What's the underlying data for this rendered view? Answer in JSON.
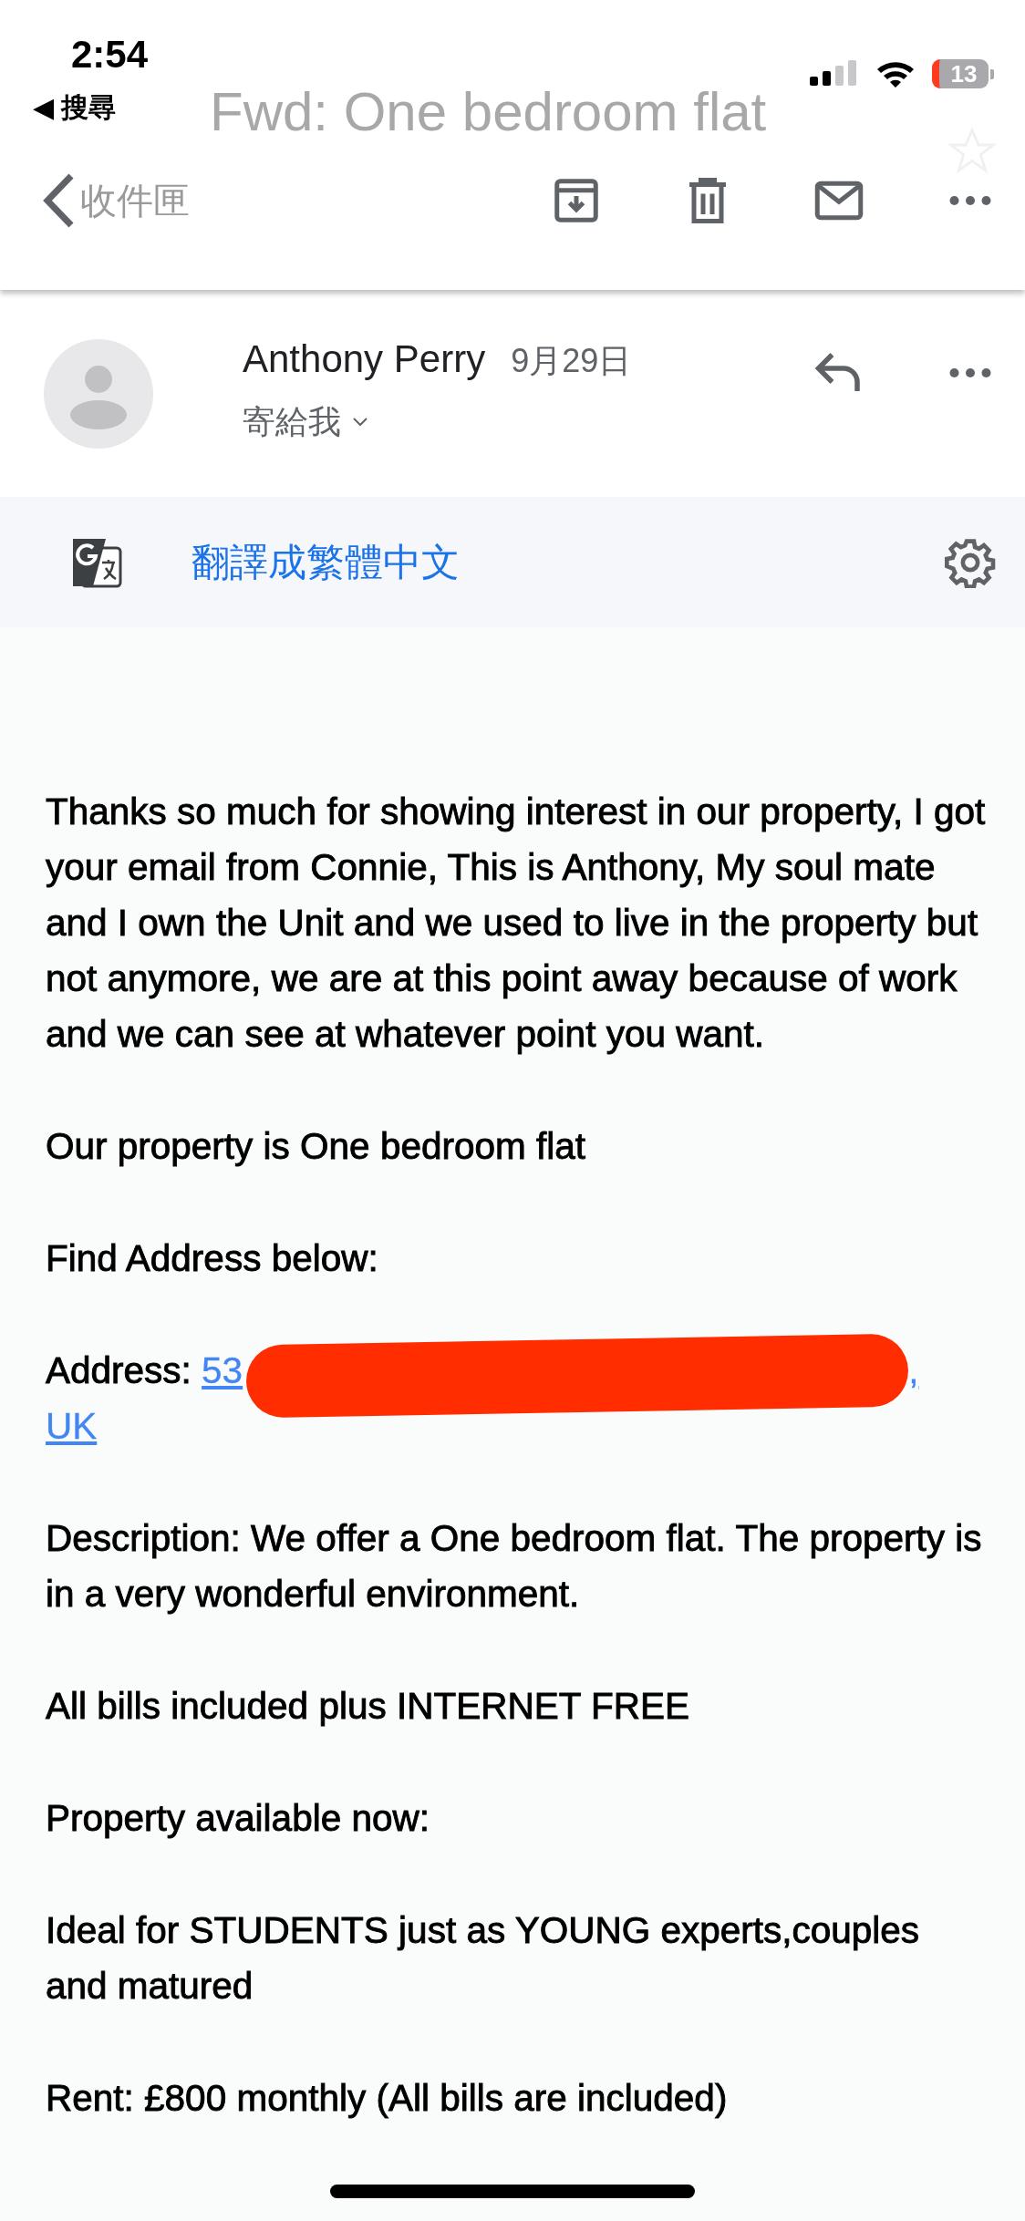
{
  "status_bar": {
    "time": "2:54",
    "back_app": "◀ 搜尋",
    "battery": "13"
  },
  "toolbar": {
    "faded_title": "Fwd: One bedroom flat",
    "back_label": "收件匣"
  },
  "sender": {
    "name": "Anthony Perry",
    "date": "9月29日",
    "recipient": "寄給我"
  },
  "translate_bar": {
    "label": "翻譯成繁體中文"
  },
  "body": [
    {
      "kind": "text",
      "text": "Thanks so much for showing interest in our property, I got your email from Connie, This is Anthony, My soul mate and I own the Unit and we used to live in the property but not anymore, we are at this point away because of work and we can see at whatever point you want."
    },
    {
      "kind": "text",
      "text": "Our property is One bedroom flat"
    },
    {
      "kind": "text",
      "text": "Find Address below:"
    },
    {
      "kind": "address",
      "label": "Address:",
      "link_start": "53",
      "link_end": ",",
      "link_last": "UK",
      "redacted": true
    },
    {
      "kind": "text",
      "text": "Description: We offer a One bedroom flat. The property is in a very wonderful environment."
    },
    {
      "kind": "text",
      "text": "All bills included plus INTERNET FREE"
    },
    {
      "kind": "text",
      "text": "Property available now:"
    },
    {
      "kind": "text",
      "text": "Ideal for STUDENTS just as YOUNG experts,couples and matured"
    },
    {
      "kind": "text",
      "text": "Rent: £800 monthly (All bills are included)"
    }
  ]
}
